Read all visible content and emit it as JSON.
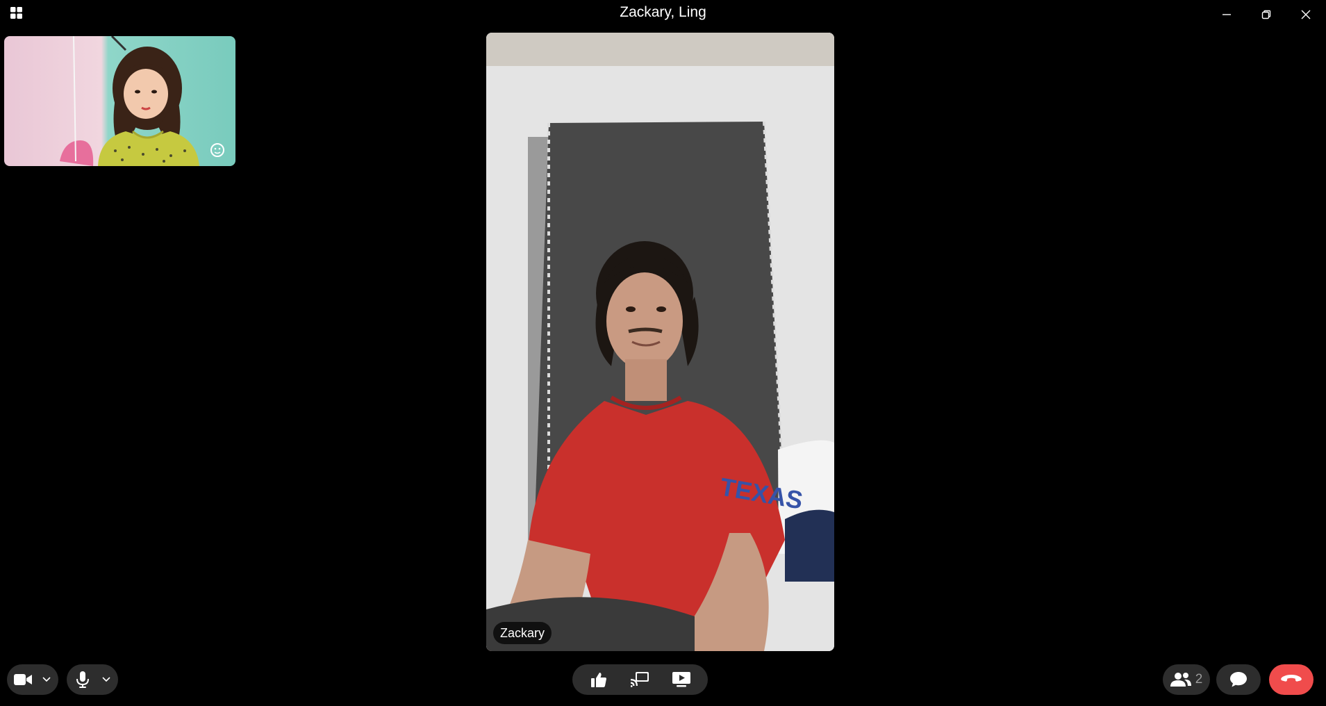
{
  "window": {
    "title": "Zackary, Ling"
  },
  "main_video": {
    "participant_name": "Zackary"
  },
  "icons": {
    "grid": "grid-icon",
    "minimize": "minimize-icon",
    "restore": "restore-icon",
    "close": "close-icon",
    "camera": "video-camera-icon",
    "microphone": "microphone-icon",
    "reaction": "thumbs-up-icon",
    "cast": "cast-icon",
    "share_screen": "share-screen-icon",
    "participants": "participants-icon",
    "chat": "chat-icon",
    "end_call": "end-call-icon"
  },
  "bottom_bar": {
    "participants_count": "2"
  },
  "colors": {
    "background": "#000000",
    "control_pill": "#2d2d2d",
    "end_call": "#f04c4c",
    "muted_text": "#9a9a9a"
  }
}
